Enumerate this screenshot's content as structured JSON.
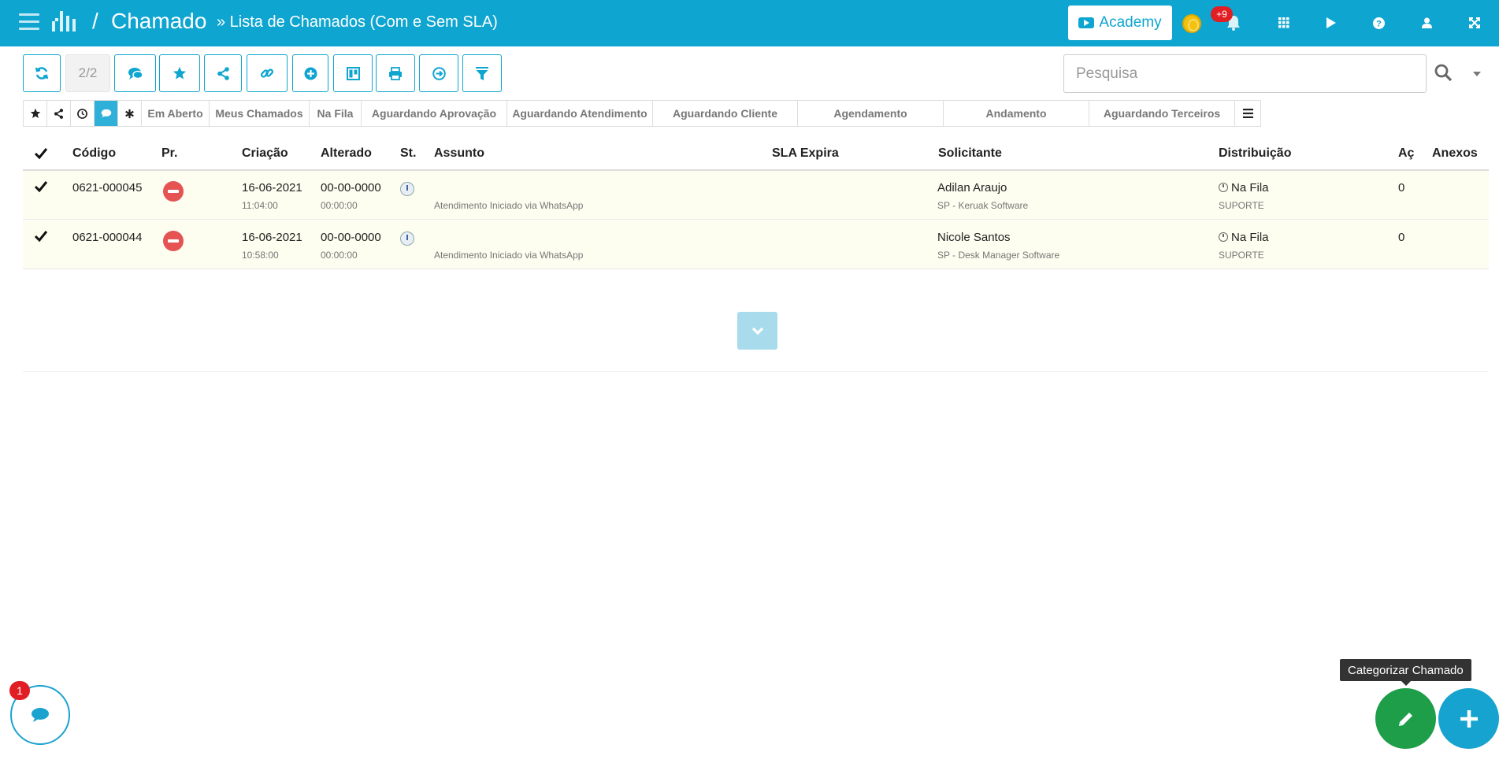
{
  "header": {
    "brand": "Chamado",
    "slash": "/",
    "breadcrumb": "» Lista de Chamados (Com e Sem SLA)",
    "academy_label": "Academy",
    "notification_count": "+9",
    "icons": [
      "menu-icon",
      "bell-icon",
      "apps-grid-icon",
      "play-icon",
      "help-icon",
      "user-icon",
      "fullscreen-icon"
    ]
  },
  "toolbar": {
    "pagination": "2/2",
    "buttons": [
      "refresh-icon",
      "chat-icon",
      "star-icon",
      "share-icon",
      "link-icon",
      "add-circle-icon",
      "kanban-icon",
      "print-icon",
      "arrow-right-circle-icon",
      "filter-icon"
    ],
    "search_placeholder": "Pesquisa"
  },
  "filter_tabs": {
    "icon_tabs": [
      "star-icon",
      "share-icon",
      "clock-icon",
      "chat-icon",
      "asterisk-icon"
    ],
    "labels": [
      "Em Aberto",
      "Meus Chamados",
      "Na Fila",
      "Aguardando Aprovação",
      "Aguardando Atendimento",
      "Aguardando Cliente",
      "Agendamento",
      "Andamento",
      "Aguardando Terceiros"
    ],
    "active_index": 3
  },
  "table": {
    "headers": {
      "codigo": "Código",
      "pr": "Pr.",
      "criacao": "Criação",
      "alterado": "Alterado",
      "st": "St.",
      "assunto": "Assunto",
      "sla": "SLA Expira",
      "solicitante": "Solicitante",
      "distribuicao": "Distribuição",
      "ac": "Aç",
      "anexos": "Anexos"
    },
    "rows": [
      {
        "codigo": "0621-000045",
        "criacao_data": "16-06-2021",
        "criacao_hora": "11:04:00",
        "alterado_data": "00-00-0000",
        "alterado_hora": "00:00:00",
        "assunto": "Atendimento Iniciado via WhatsApp",
        "solicitante": "Adilan Araujo",
        "solicitante_empresa": "SP - Keruak Software",
        "distribuicao": "Na Fila",
        "distribuicao_grupo": "SUPORTE",
        "acoes": "0"
      },
      {
        "codigo": "0621-000044",
        "criacao_data": "16-06-2021",
        "criacao_hora": "10:58:00",
        "alterado_data": "00-00-0000",
        "alterado_hora": "00:00:00",
        "assunto": "Atendimento Iniciado via WhatsApp",
        "solicitante": "Nicole Santos",
        "solicitante_empresa": "SP - Desk Manager Software",
        "distribuicao": "Na Fila",
        "distribuicao_grupo": "SUPORTE",
        "acoes": "0"
      }
    ]
  },
  "floating": {
    "chat_badge": "1",
    "tooltip": "Categorizar Chamado"
  },
  "colors": {
    "primary": "#0ea5d0",
    "priority_high": "#e55353",
    "fab_green": "#1f9e4a",
    "row_bg": "#fdfdf0"
  }
}
